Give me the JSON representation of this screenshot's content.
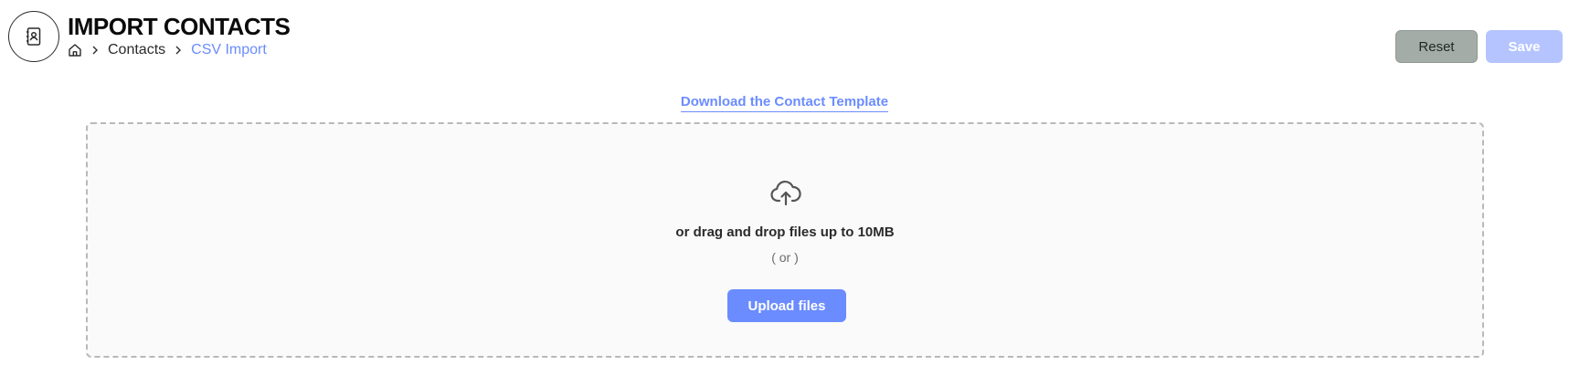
{
  "header": {
    "icon": "contact-book-icon",
    "title": "IMPORT CONTACTS",
    "breadcrumb": {
      "home_icon": "home-icon",
      "separator_icon": "chevron-right-icon",
      "items": [
        "Contacts",
        "CSV Import"
      ]
    },
    "buttons": {
      "reset_label": "Reset",
      "save_label": "Save"
    }
  },
  "main": {
    "template_link": "Download the Contact Template",
    "dropzone": {
      "icon": "cloud-upload-icon",
      "drop_text": "or drag and drop files up to 10MB",
      "or_text": "( or )",
      "upload_label": "Upload files"
    }
  },
  "colors": {
    "accent": "#6b8cff",
    "save_disabled": "#b5c4ff",
    "reset_bg": "#a3aca6",
    "dropzone_border": "#b9b9b9",
    "dropzone_bg": "#fafafa"
  }
}
